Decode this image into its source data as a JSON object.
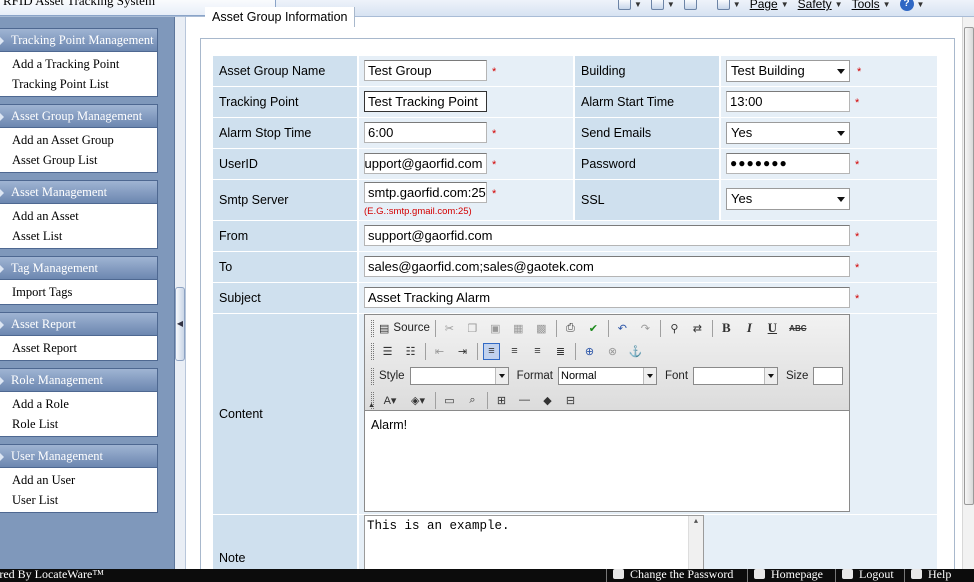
{
  "browser": {
    "tab_title": "RFID Asset Tracking System",
    "commands": {
      "page": "Page",
      "safety": "Safety",
      "tools": "Tools",
      "help": "?"
    }
  },
  "sidebar": {
    "groups": [
      {
        "title": "Tracking Point Management",
        "items": [
          "Add a Tracking Point",
          "Tracking Point List"
        ]
      },
      {
        "title": "Asset Group Management",
        "items": [
          "Add an Asset Group",
          "Asset Group List"
        ]
      },
      {
        "title": "Asset Management",
        "items": [
          "Add an Asset",
          "Asset List"
        ]
      },
      {
        "title": "Tag Management",
        "items": [
          "Import Tags"
        ]
      },
      {
        "title": "Asset Report",
        "items": [
          "Asset Report"
        ]
      },
      {
        "title": "Role Management",
        "items": [
          "Add a Role",
          "Role List"
        ]
      },
      {
        "title": "User Management",
        "items": [
          "Add an User",
          "User List"
        ]
      }
    ]
  },
  "form": {
    "legend": "Asset Group Information",
    "required_mark": "*",
    "fields": {
      "asset_group_name": {
        "label": "Asset Group Name",
        "value": "Test Group"
      },
      "building": {
        "label": "Building",
        "value": "Test Building"
      },
      "tracking_point": {
        "label": "Tracking Point",
        "value": "Test Tracking Point"
      },
      "alarm_start": {
        "label": "Alarm Start Time",
        "value": "13:00"
      },
      "alarm_stop": {
        "label": "Alarm Stop Time",
        "value": "6:00"
      },
      "send_emails": {
        "label": "Send Emails",
        "value": "Yes"
      },
      "userid": {
        "label": "UserID",
        "value": "support@gaorfid.com"
      },
      "password": {
        "label": "Password",
        "value": "●●●●●●●"
      },
      "smtp": {
        "label": "Smtp Server",
        "value": "smtp.gaorfid.com:25",
        "hint": "(E.G.:smtp.gmail.com:25)"
      },
      "ssl": {
        "label": "SSL",
        "value": "Yes"
      },
      "from": {
        "label": "From",
        "value": "support@gaorfid.com"
      },
      "to": {
        "label": "To",
        "value": "sales@gaorfid.com;sales@gaotek.com"
      },
      "subject": {
        "label": "Subject",
        "value": "Asset Tracking Alarm"
      },
      "content": {
        "label": "Content",
        "value": "Alarm!"
      },
      "note": {
        "label": "Note",
        "value": "This is an example."
      }
    },
    "editor": {
      "source_label": "Source",
      "style_label": "Style",
      "format_label": "Format",
      "format_value": "Normal",
      "font_label": "Font",
      "size_label": "Size",
      "bold": "B",
      "italic": "I",
      "underline": "U",
      "strike": "ABC"
    }
  },
  "statusbar": {
    "powered": "ered By LocateWare™",
    "change_password": "Change the Password",
    "homepage": "Homepage",
    "logout": "Logout",
    "help": "Help"
  }
}
